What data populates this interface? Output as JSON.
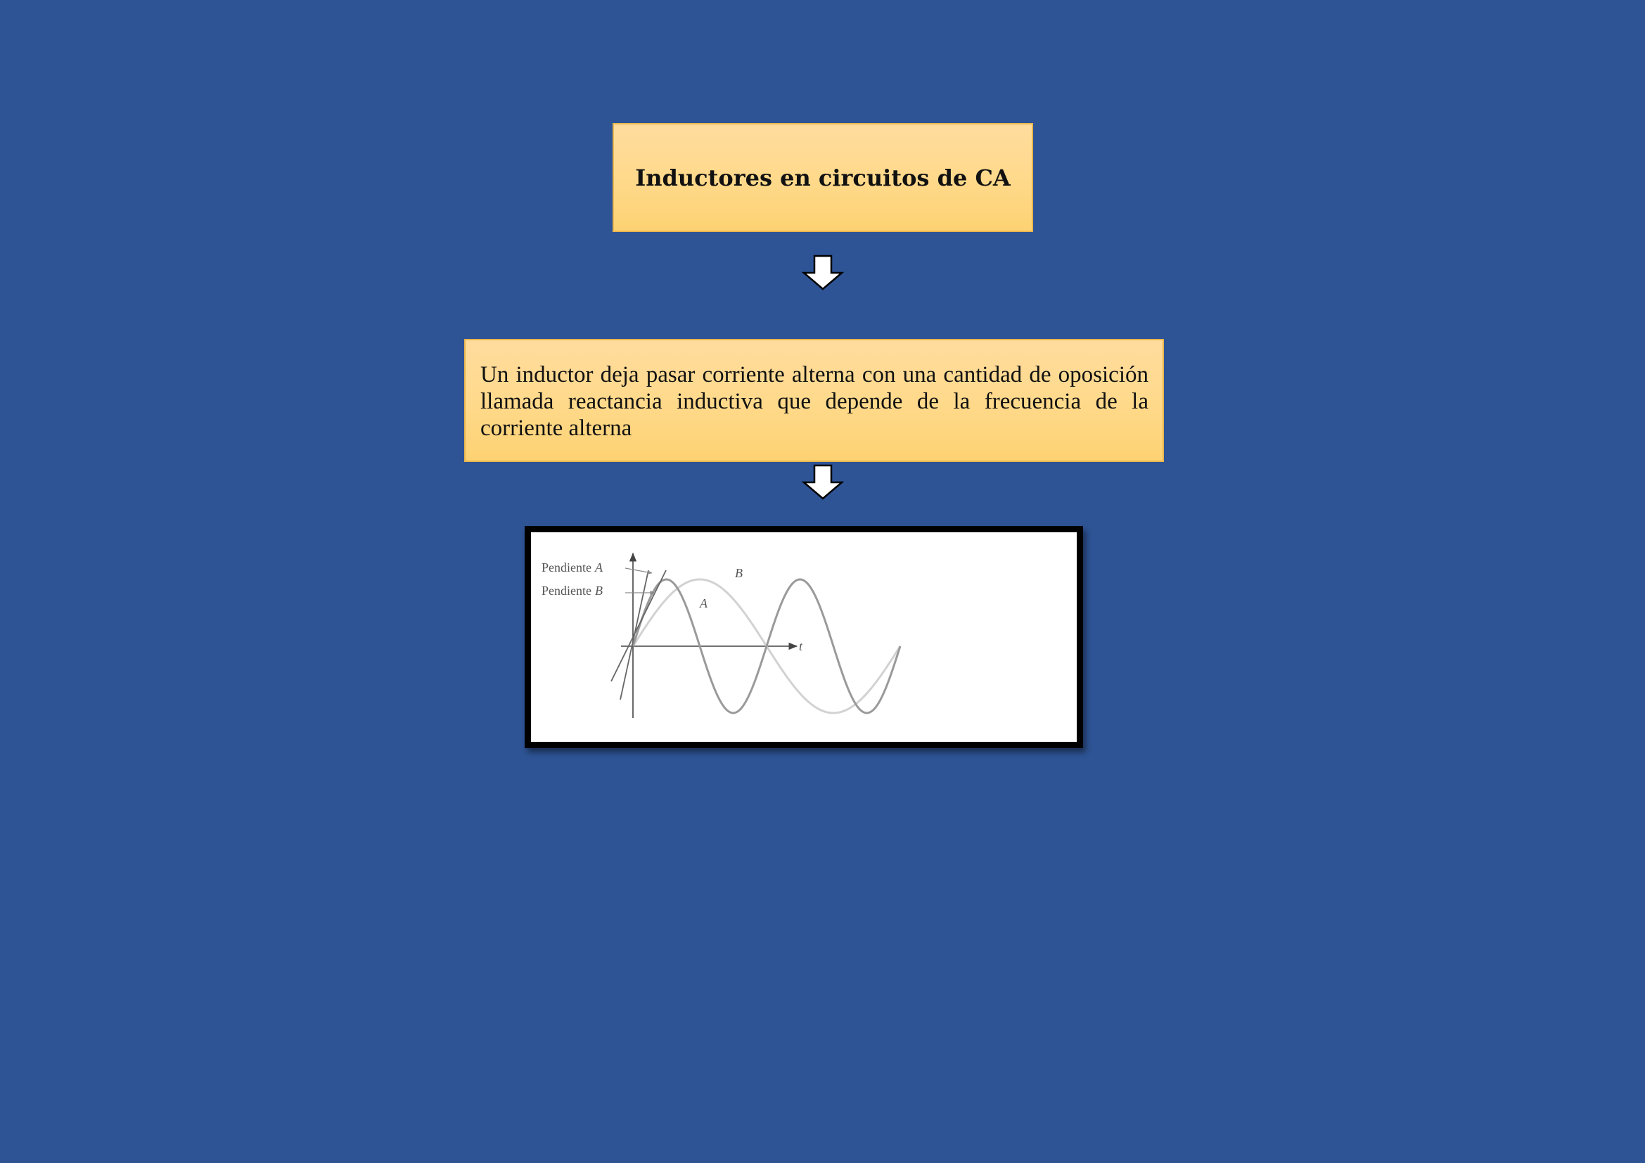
{
  "title": "Inductores en circuitos de CA",
  "description": "Un inductor deja pasar corriente alterna con una cantidad de oposición llamada reactancia inductiva que depende de la frecuencia de la corriente alterna",
  "figure": {
    "slope_a_prefix": "Pendiente",
    "slope_a_letter": "A",
    "slope_b_prefix": "Pendiente",
    "slope_b_letter": "B",
    "curve_a_label": "A",
    "curve_b_label": "B",
    "time_axis_label": "t",
    "curve_a_cycles": 2,
    "curve_b_cycles": 1,
    "curve_a_color": "#9a9a9a",
    "curve_b_color": "#d2d2d2"
  },
  "colors": {
    "background": "#2e5495",
    "box_fill": "#ffd98a",
    "box_border": "#e9b64e",
    "arrow_fill": "#ffffff"
  }
}
